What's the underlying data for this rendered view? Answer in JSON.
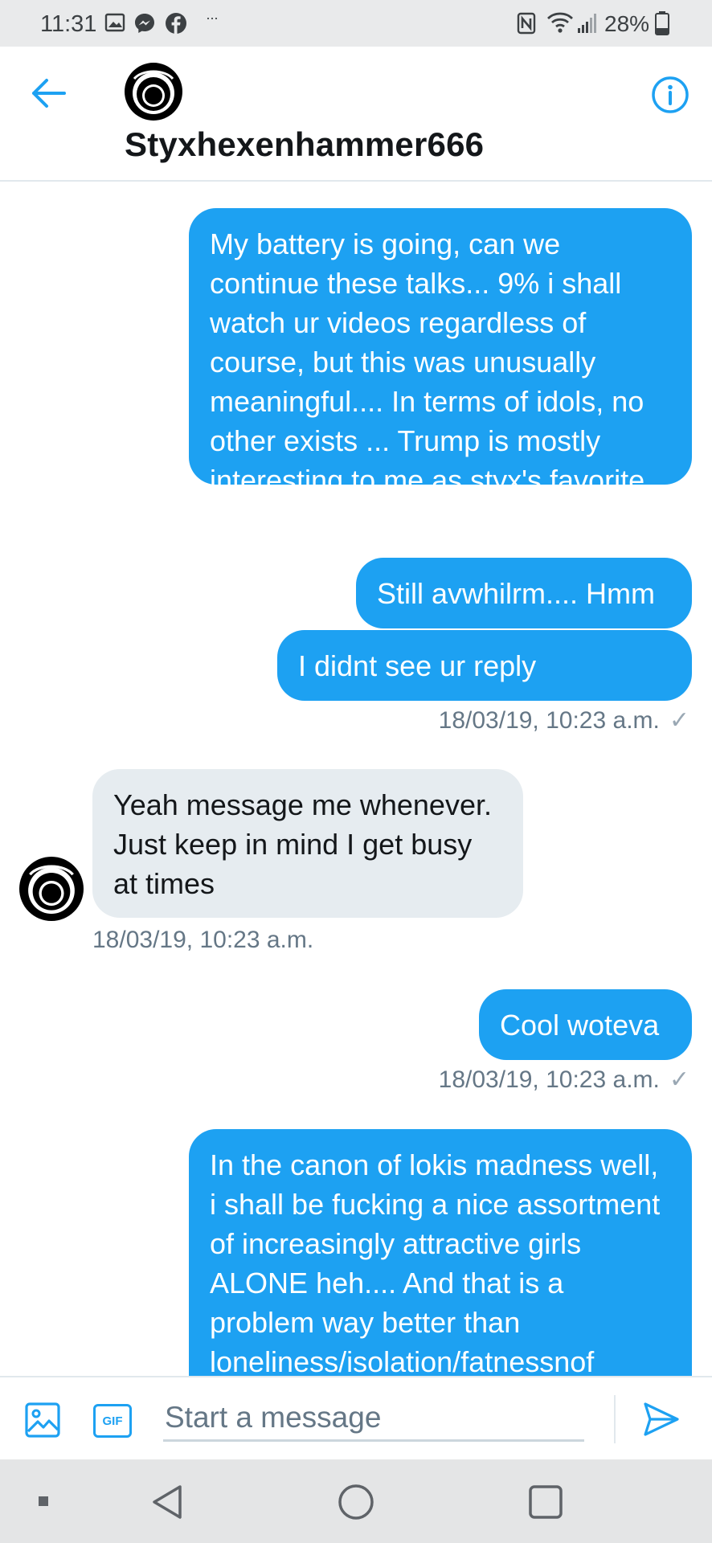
{
  "status_bar": {
    "time": "11:31",
    "left_icons": [
      "gallery-icon",
      "messenger-icon",
      "facebook-icon",
      "more-notifications-icon"
    ],
    "right_icons": [
      "nfc-icon",
      "wifi-icon",
      "signal-icon",
      "battery-icon"
    ],
    "battery": "28%",
    "more_notifications": "···"
  },
  "header": {
    "contact_name": "Styxhexenhammer666",
    "avatar_icon": "avatar-ring-icon",
    "back_icon": "back-arrow-icon",
    "info_icon": "info-icon"
  },
  "messages": [
    {
      "direction": "sent",
      "text": "My battery is going, can we continue these talks... 9% i shall watch ur videos regardless of course, but this was unusually meaningful.... In terms of idols, no other exists ... Trump is mostly interesting to me as styx's favorite politician."
    },
    {
      "direction": "sent",
      "text": "Still avwhilrm.... Hmm"
    },
    {
      "direction": "sent",
      "text": "I didnt see ur reply"
    },
    {
      "direction": "received",
      "text": "Yeah message me whenever. Just keep in mind I get busy at times"
    },
    {
      "direction": "sent",
      "text": "Cool woteva"
    },
    {
      "direction": "sent",
      "text": "In the canon of lokis madness well, i shall be fucking a nice assortment of increasingly attractive girls ALONE heh.... And that is a problem way better than loneliness/isolation/fatnessnof"
    }
  ],
  "timestamps": {
    "group1": "18/03/19, 10:23 a.m.",
    "group2": "18/03/19, 10:23 a.m.",
    "group3": "18/03/19, 10:23 a.m."
  },
  "read_check": "✓",
  "composer": {
    "placeholder": "Start a message",
    "gif_label": "GIF",
    "media_icon": "image-icon",
    "send_icon": "send-icon"
  },
  "nav_bar": {
    "items": [
      "recents-dot-icon",
      "back-triangle-icon",
      "home-circle-icon",
      "overview-square-icon"
    ]
  },
  "colors": {
    "accent": "#1da1f2",
    "received_bubble": "#e6ecf0",
    "timestamp": "#657786",
    "status_bar": "#e9eaeb"
  }
}
